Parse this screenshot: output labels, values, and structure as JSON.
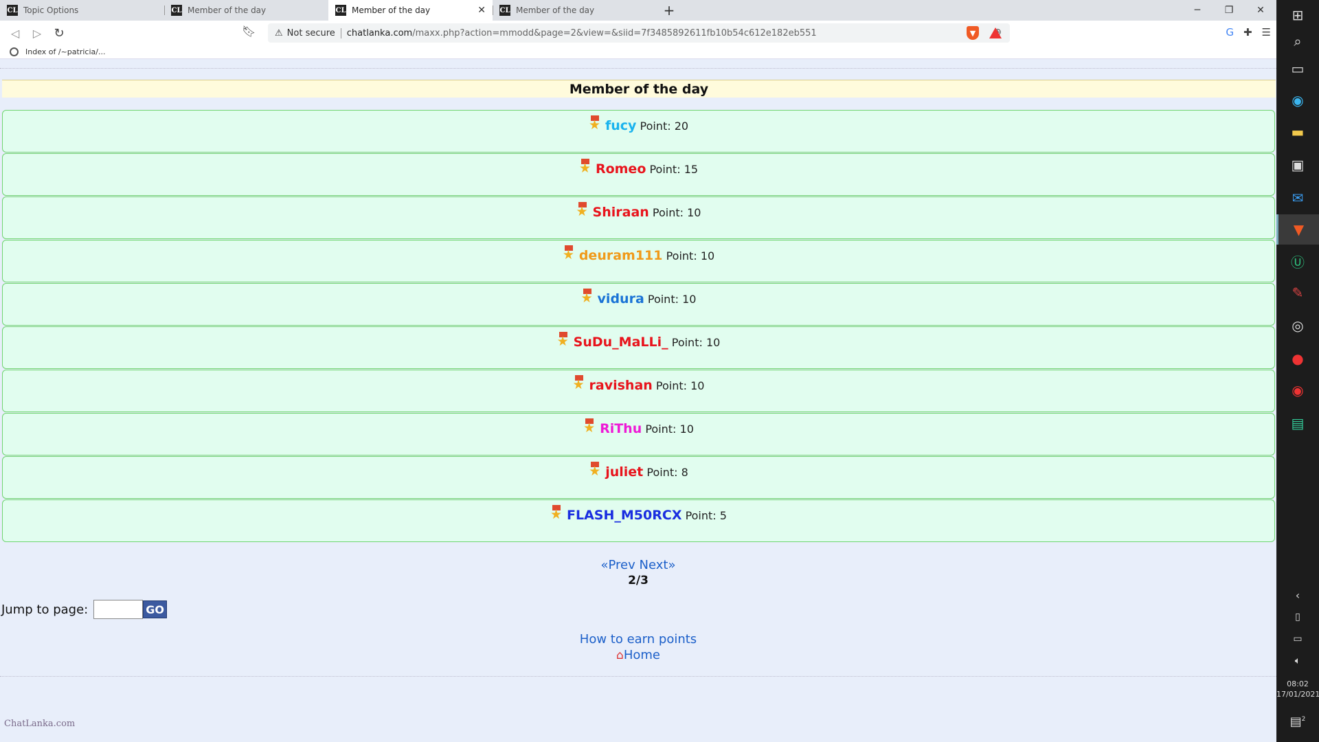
{
  "browser": {
    "tabs": [
      {
        "title": "Topic Options",
        "active": false
      },
      {
        "title": "Member of the day",
        "active": false
      },
      {
        "title": "Member of the day",
        "active": true
      },
      {
        "title": "Member of the day",
        "active": false
      }
    ],
    "tab_icon_text": "CL",
    "address": {
      "security": "Not secure",
      "host": "chatlanka.com",
      "path": "/maxx.php?action=mmodd&page=2&view=&siid=7f3485892611fb10b54c612e182eb551"
    },
    "bookmark": "Index of /~patricia/..."
  },
  "page": {
    "header": "Member of the day",
    "point_label": "Point:",
    "members": [
      {
        "name": "fucy",
        "points": "20",
        "color": "#1ab3ee"
      },
      {
        "name": "Romeo",
        "points": "15",
        "color": "#e8141c"
      },
      {
        "name": "Shiraan",
        "points": "10",
        "color": "#e8141c"
      },
      {
        "name": "deuram111",
        "points": "10",
        "color": "#f09a1a"
      },
      {
        "name": "vidura",
        "points": "10",
        "color": "#1a73d6"
      },
      {
        "name": "SuDu_MaLLi_",
        "points": "10",
        "color": "#e8141c"
      },
      {
        "name": "ravishan",
        "points": "10",
        "color": "#e8141c"
      },
      {
        "name": "RiThu",
        "points": "10",
        "color": "#ee1ad6"
      },
      {
        "name": "juliet",
        "points": "8",
        "color": "#e8141c"
      },
      {
        "name": "FLASH_M50RCX",
        "points": "5",
        "color": "#1a2ee0"
      }
    ],
    "pager": {
      "prev": "«Prev",
      "next": "Next»",
      "page_count": "2/3"
    },
    "jump": {
      "label": "Jump to page:",
      "input_value": "",
      "go_label": "GO"
    },
    "links": {
      "earn_points": "How to earn points",
      "home": "Home"
    },
    "logo": "ChatLanka.com"
  },
  "taskbar": {
    "time": "08:02",
    "date": "17/01/2021",
    "notification_count": "2"
  }
}
